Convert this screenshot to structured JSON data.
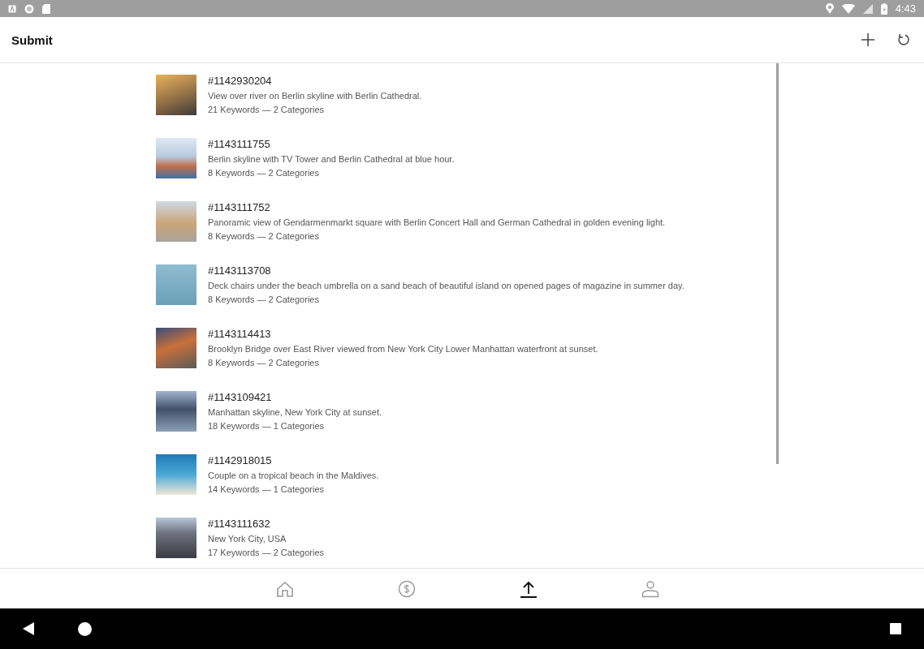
{
  "status_bar": {
    "time": "4:43"
  },
  "app_bar": {
    "title": "Submit"
  },
  "submissions": [
    {
      "id": "#1142930204",
      "description": "View over river on Berlin skyline with Berlin Cathedral.",
      "meta": "21 Keywords — 2 Categories"
    },
    {
      "id": "#1143111755",
      "description": "Berlin skyline with TV Tower and Berlin Cathedral at blue hour.",
      "meta": "8 Keywords — 2 Categories"
    },
    {
      "id": "#1143111752",
      "description": "Panoramic view of Gendarmenmarkt square with Berlin Concert Hall and German Cathedral in golden evening light.",
      "meta": "8 Keywords — 2 Categories"
    },
    {
      "id": "#1143113708",
      "description": "Deck chairs under the beach umbrella on a sand beach of beautiful island on opened pages of magazine in summer day.",
      "meta": "8 Keywords — 2 Categories"
    },
    {
      "id": "#1143114413",
      "description": "Brooklyn Bridge over East River viewed from New York City Lower Manhattan waterfront at sunset.",
      "meta": "8 Keywords — 2 Categories"
    },
    {
      "id": "#1143109421",
      "description": "Manhattan skyline, New York City at sunset.",
      "meta": "18 Keywords — 1 Categories"
    },
    {
      "id": "#1142918015",
      "description": "Couple on a tropical beach in the Maldives.",
      "meta": "14 Keywords — 1 Categories"
    },
    {
      "id": "#1143111632",
      "description": "New York City, USA",
      "meta": "17 Keywords — 2 Categories"
    }
  ],
  "bottom_nav": [
    {
      "kind": "home",
      "selected": false
    },
    {
      "kind": "earnings",
      "selected": false
    },
    {
      "kind": "upload",
      "selected": true
    },
    {
      "kind": "profile",
      "selected": false
    }
  ]
}
